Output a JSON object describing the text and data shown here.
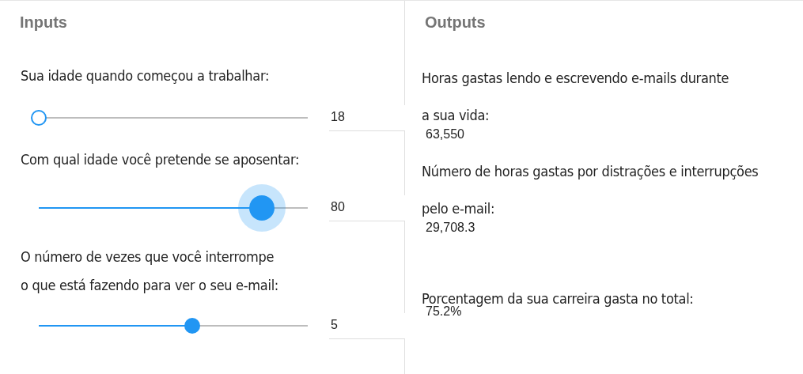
{
  "inputs": {
    "title": "Inputs",
    "sliders": [
      {
        "label_lines": [
          "Sua idade quando começou a trabalhar:"
        ],
        "level": 0,
        "value": "18",
        "active": false
      },
      {
        "label_lines": [
          "Com qual idade você pretende se aposentar:"
        ],
        "level": 0.83,
        "value": "80",
        "active": true
      },
      {
        "label_lines": [
          "O número de vezes que você interrompe",
          "o que está fazendo para ver o seu e-mail:"
        ],
        "level": 0.57,
        "value": "5",
        "active": false
      }
    ]
  },
  "outputs": {
    "title": "Outputs",
    "items": [
      {
        "label_lines": [
          "Horas gastas lendo e escrevendo e-mails durante",
          "a sua vida:"
        ],
        "value": "63,550"
      },
      {
        "label_lines": [
          "Número de horas gastas por distrações e interrupções",
          "pelo e-mail:"
        ],
        "value": "29,708.3"
      },
      {
        "label_lines": [
          "Porcentagem da sua carreira gasta no total:"
        ],
        "value": "75.2%"
      }
    ]
  }
}
